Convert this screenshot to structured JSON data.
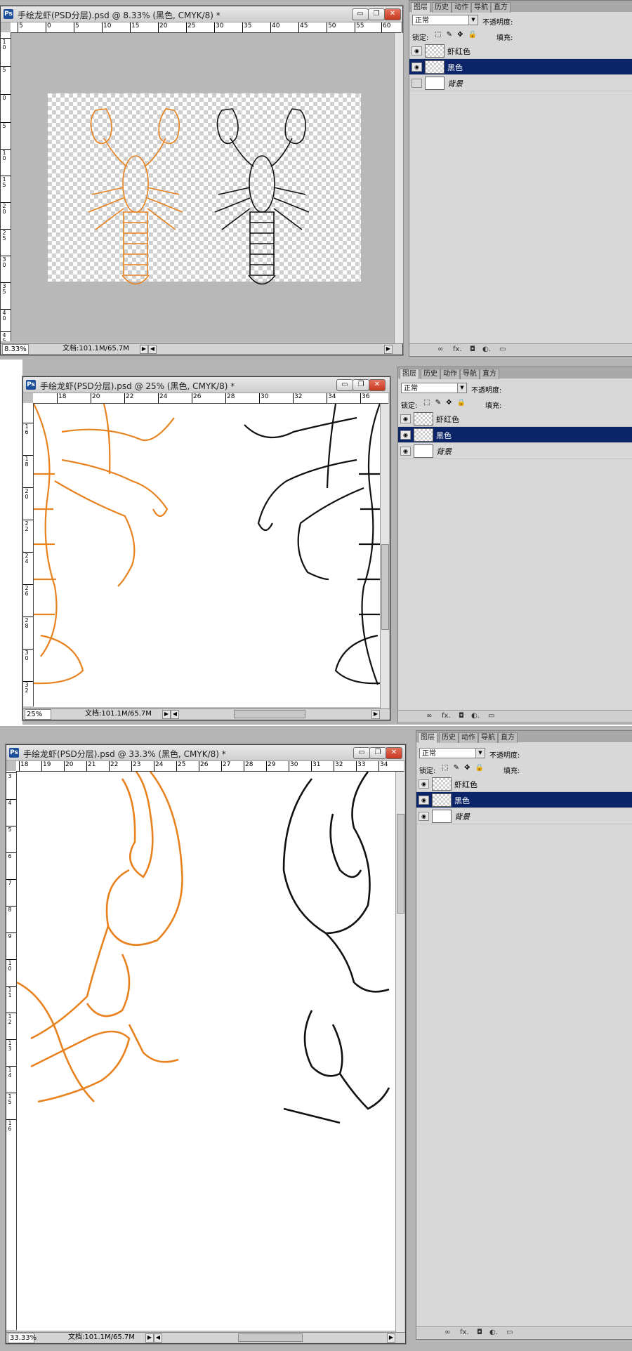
{
  "screenshots": [
    {
      "title": "手绘龙虾(PSD分层).psd @ 8.33% (黑色, CMYK/8) *",
      "zoom": "8.33%",
      "doc_info": "文档:101.1M/65.7M",
      "ruler_h": [
        "5",
        "0",
        "5",
        "10",
        "15",
        "20",
        "25",
        "30",
        "35",
        "40",
        "45",
        "50",
        "55",
        "60"
      ],
      "ruler_v": [
        "1\n0",
        "5",
        "0",
        "5",
        "1\n0",
        "1\n5",
        "2\n0",
        "2\n5",
        "3\n0",
        "3\n5",
        "4\n0",
        "4\n5"
      ]
    },
    {
      "title": "手绘龙虾(PSD分层).psd @ 25% (黑色, CMYK/8) *",
      "zoom": "25%",
      "doc_info": "文档:101.1M/65.7M",
      "ruler_h": [
        "18",
        "20",
        "22",
        "24",
        "26",
        "28",
        "30",
        "32",
        "34",
        "36"
      ],
      "ruler_v": [
        "1\n6",
        "1\n8",
        "2\n0",
        "2\n2",
        "2\n4",
        "2\n6",
        "2\n8",
        "3\n0",
        "3\n2"
      ]
    },
    {
      "title": "手绘龙虾(PSD分层).psd @ 33.3% (黑色, CMYK/8) *",
      "zoom": "33.33%",
      "doc_info": "文档:101.1M/65.7M",
      "ruler_h": [
        "18",
        "19",
        "20",
        "21",
        "22",
        "23",
        "24",
        "25",
        "26",
        "27",
        "28",
        "29",
        "30",
        "31",
        "32",
        "33",
        "34"
      ],
      "ruler_v": [
        "3",
        "4",
        "5",
        "6",
        "7",
        "8",
        "9",
        "1\n0",
        "1\n1",
        "1\n2",
        "1\n3",
        "1\n4",
        "1\n5",
        "1\n6"
      ]
    }
  ],
  "window_buttons": {
    "minimize": "▭",
    "restore": "❐",
    "close": "✕"
  },
  "layers_panel": {
    "tabs": [
      "图层",
      "历史",
      "动作",
      "导航",
      "直方"
    ],
    "blend_mode": "正常",
    "opacity_label": "不透明度:",
    "lock_label": "锁定:",
    "fill_label": "填充:",
    "lock_icons": "⬚ ✎ ✥ 🔒",
    "layers": [
      {
        "name": "虾红色",
        "visible": true,
        "thumb": "checker",
        "selected": false
      },
      {
        "name": "黑色",
        "visible": true,
        "thumb": "checker",
        "selected": true
      },
      {
        "name": "背景",
        "visible": false,
        "thumb": "white",
        "selected": false
      }
    ],
    "layers_3": [
      {
        "name": "虾红色",
        "visible": true
      },
      {
        "name": "黑色",
        "visible": true
      },
      {
        "name": "背景",
        "visible": true
      }
    ],
    "footer_icons": [
      "∞",
      "fx.",
      "◘",
      "◐.",
      "▭",
      "🗑"
    ]
  },
  "colors": {
    "orange": "#e8821f",
    "ink": "#111111",
    "selected": "#0c2468"
  }
}
